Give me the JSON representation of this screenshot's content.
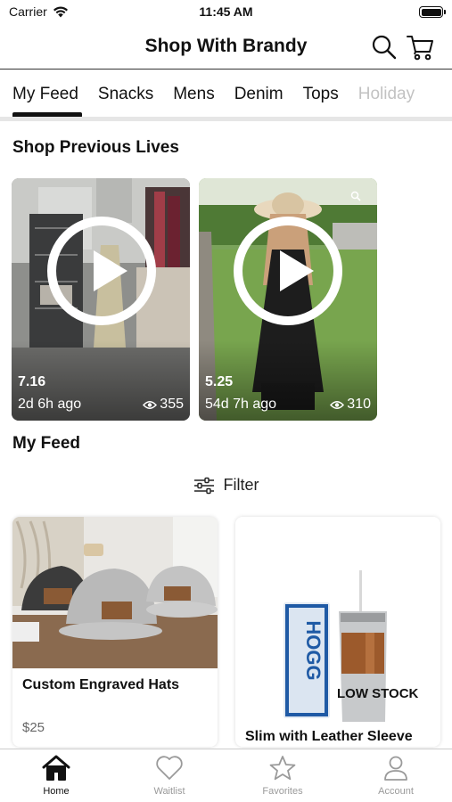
{
  "status_bar": {
    "carrier": "Carrier",
    "time": "11:45 AM"
  },
  "header": {
    "title": "Shop With Brandy",
    "search_icon": "search-icon",
    "cart_icon": "cart-icon"
  },
  "tabs": [
    {
      "label": "My Feed",
      "active": true
    },
    {
      "label": "Snacks"
    },
    {
      "label": "Mens"
    },
    {
      "label": "Denim"
    },
    {
      "label": "Tops"
    },
    {
      "label": "Holiday"
    }
  ],
  "previous_lives": {
    "title": "Shop Previous Lives",
    "items": [
      {
        "date": "7.16",
        "ago": "2d 6h ago",
        "views": "355"
      },
      {
        "date": "5.25",
        "ago": "54d 7h ago",
        "views": "310"
      }
    ]
  },
  "feed": {
    "title": "My Feed",
    "filter_label": "Filter",
    "products": [
      {
        "name": "Custom Engraved Hats",
        "price": "$25"
      },
      {
        "name": "Slim with Leather Sleeve",
        "badge": "LOW STOCK",
        "tumbler_text": "HOGG"
      }
    ]
  },
  "tabbar": [
    {
      "label": "Home",
      "icon": "home-icon",
      "active": true
    },
    {
      "label": "Waitlist",
      "icon": "heart-icon"
    },
    {
      "label": "Favorites",
      "icon": "star-icon"
    },
    {
      "label": "Account",
      "icon": "user-icon"
    }
  ]
}
